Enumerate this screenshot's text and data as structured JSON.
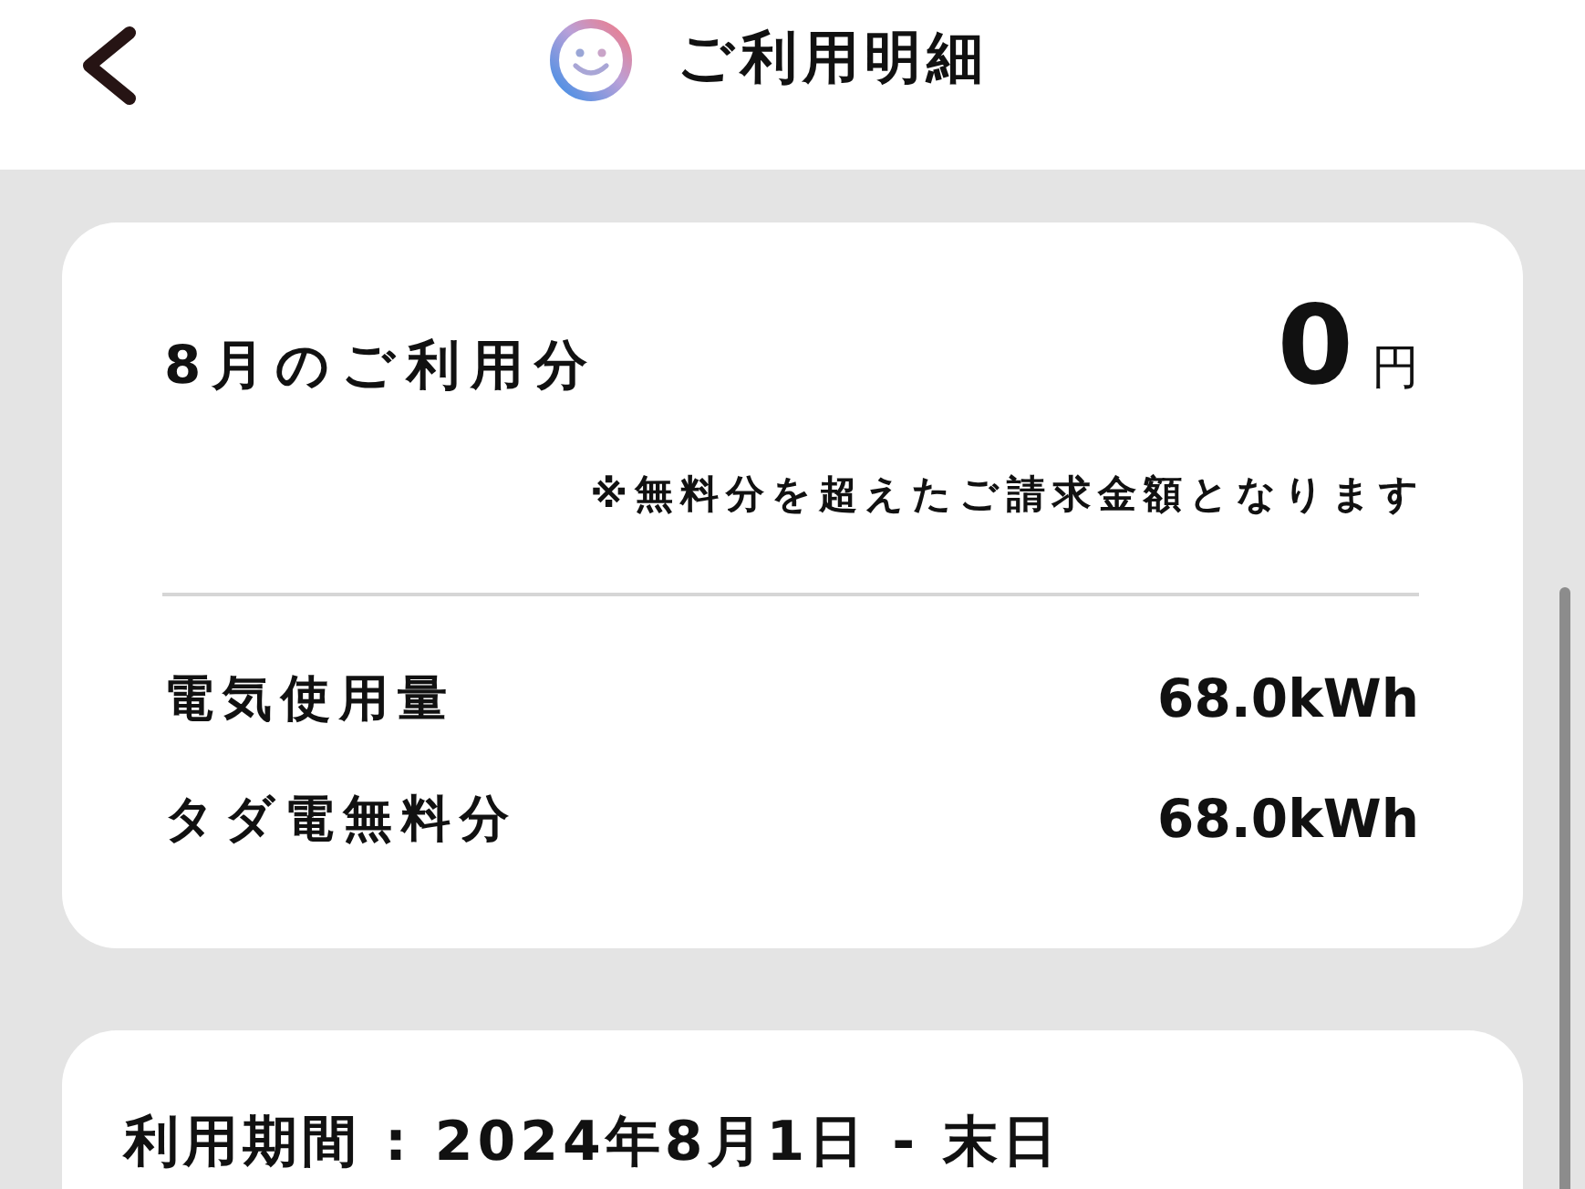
{
  "header": {
    "title": "ご利用明細"
  },
  "summary": {
    "label": "8月のご利用分",
    "amount": "0",
    "unit": "円",
    "note": "※無料分を超えたご請求金額となります",
    "rows": [
      {
        "label": "電気使用量",
        "value": "68.0kWh"
      },
      {
        "label": "タダ電無料分",
        "value": "68.0kWh"
      }
    ]
  },
  "period": {
    "text": "利用期間 : 2024年8月1日 - 末日"
  }
}
